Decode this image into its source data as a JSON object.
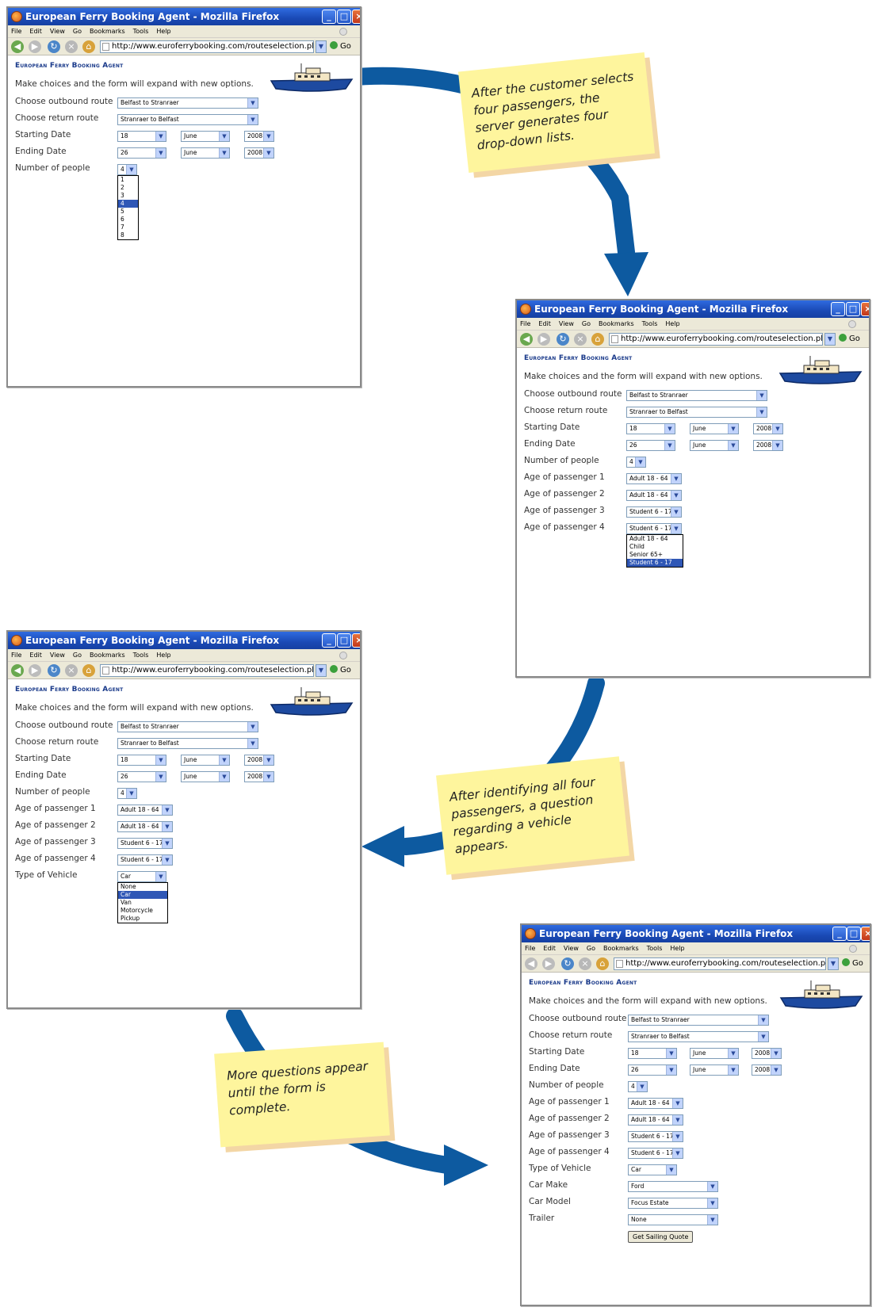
{
  "browser": {
    "title": "European Ferry Booking Agent - Mozilla Firefox",
    "menu": [
      "File",
      "Edit",
      "View",
      "Go",
      "Bookmarks",
      "Tools",
      "Help"
    ],
    "url": "http://www.euroferrybooking.com/routeselection.php",
    "go_label": "Go"
  },
  "page": {
    "brand": "European Ferry Booking Agent",
    "intro": "Make choices and the form will expand with new options.",
    "labels": {
      "outbound": "Choose outbound route",
      "return": "Choose return route",
      "start": "Starting Date",
      "end": "Ending Date",
      "people": "Number of people",
      "p1": "Age of passenger 1",
      "p2": "Age of passenger 2",
      "p3": "Age of passenger 3",
      "p4": "Age of passenger 4",
      "vehicle": "Type of Vehicle",
      "make": "Car Make",
      "model": "Car Model",
      "trailer": "Trailer"
    },
    "values": {
      "outbound": "Belfast to Stranraer",
      "return": "Stranraer to Belfast",
      "start_day": "18",
      "start_month": "June",
      "start_year": "2008",
      "end_day": "26",
      "end_month": "June",
      "end_year": "2008",
      "people": "4",
      "p1": "Adult 18 - 64",
      "p2": "Adult 18 - 64",
      "p3": "Student 6 - 17",
      "p4": "Student 6 - 17",
      "vehicle": "Car",
      "make": "Ford",
      "model": "Focus Estate",
      "trailer": "None"
    },
    "people_options": [
      "1",
      "2",
      "3",
      "4",
      "5",
      "6",
      "7",
      "8"
    ],
    "people_selected": "4",
    "age_options": [
      "Adult 18 - 64",
      "Child",
      "Senior 65+",
      "Student 6 - 17"
    ],
    "age_selected": "Student 6 - 17",
    "vehicle_options": [
      "None",
      "Car",
      "Van",
      "Motorcycle",
      "Pickup"
    ],
    "vehicle_selected": "Car",
    "quote_button": "Get Sailing Quote"
  },
  "notes": {
    "n1": "After the customer selects four passengers, the server generates four drop-down lists.",
    "n2": "After identifying all four passengers, a question regarding a vehicle appears.",
    "n3": "More questions appear until the form is complete."
  },
  "colors": {
    "arrow": "#0d5aa0",
    "note": "#fef59d",
    "note_shadow": "#f3d6a5",
    "titlebar": "#1f55c4",
    "brand": "#1a3a8a",
    "selection": "#2f57b6"
  }
}
